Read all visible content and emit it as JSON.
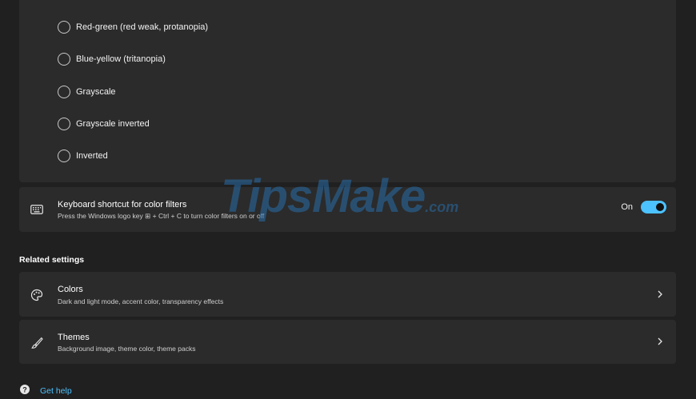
{
  "color_filters": {
    "options": [
      {
        "label": "Red-green (red weak, protanopia)",
        "selected": false
      },
      {
        "label": "Blue-yellow (tritanopia)",
        "selected": false
      },
      {
        "label": "Grayscale",
        "selected": false
      },
      {
        "label": "Grayscale inverted",
        "selected": false
      },
      {
        "label": "Inverted",
        "selected": false
      }
    ]
  },
  "shortcut_card": {
    "icon": "keyboard-icon",
    "title": "Keyboard shortcut for color filters",
    "description": "Press the Windows logo key ⊞ + Ctrl + C to turn color filters on or off",
    "toggle_state": "On",
    "toggle_on": true
  },
  "related": {
    "heading": "Related settings",
    "items": [
      {
        "icon": "palette-icon",
        "title": "Colors",
        "description": "Dark and light mode, accent color, transparency effects"
      },
      {
        "icon": "brush-icon",
        "title": "Themes",
        "description": "Background image, theme color, theme packs"
      }
    ]
  },
  "help": {
    "icon": "help-icon",
    "label": "Get help"
  },
  "watermark": {
    "text": "TipsMake",
    "suffix": ".com"
  },
  "colors": {
    "accent": "#4cc2ff",
    "card_bg": "#2b2b2b",
    "page_bg": "#202020"
  }
}
